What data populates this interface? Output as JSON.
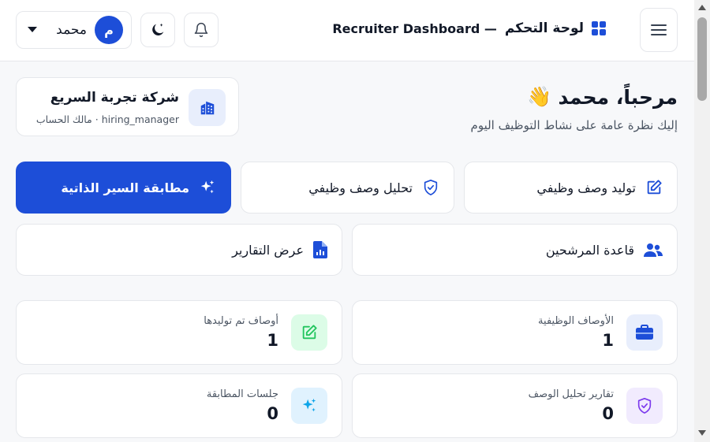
{
  "header": {
    "title_ar": "لوحة التحكم",
    "title_en": "Recruiter Dashboard —",
    "user_initial": "م",
    "user_name": "محمد"
  },
  "welcome": {
    "title": "مرحباً، محمد",
    "emoji": "👋",
    "subtitle": "إليك نظرة عامة على نشاط التوظيف اليوم"
  },
  "company": {
    "name": "شركة تجربة السريع",
    "meta": "hiring_manager · مالك الحساب"
  },
  "actions": [
    {
      "label": "توليد وصف وظيفي",
      "icon": "edit-icon"
    },
    {
      "label": "تحليل وصف وظيفي",
      "icon": "shield-check-icon"
    },
    {
      "label": "مطابقة السير الذاتية",
      "icon": "sparkles-icon"
    },
    {
      "label": "قاعدة المرشحين",
      "icon": "users-icon"
    },
    {
      "label": "عرض التقارير",
      "icon": "report-icon"
    }
  ],
  "stats": [
    {
      "label": "الأوصاف الوظيفية",
      "value": "1",
      "icon": "briefcase-icon"
    },
    {
      "label": "أوصاف تم توليدها",
      "value": "1",
      "icon": "edit-icon"
    },
    {
      "label": "تقارير تحليل الوصف",
      "value": "0",
      "icon": "shield-check-icon"
    },
    {
      "label": "جلسات المطابقة",
      "value": "0",
      "icon": "sparkles-icon"
    }
  ],
  "colors": {
    "primary": "#1d4ed8",
    "green": "#22c55e",
    "purple": "#7c3aed",
    "sky": "#0ea5e9"
  }
}
